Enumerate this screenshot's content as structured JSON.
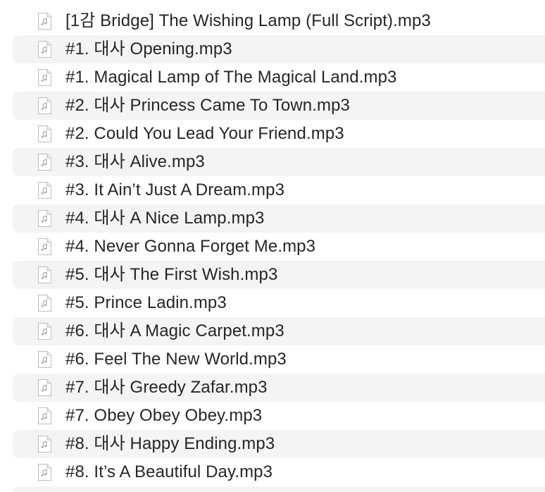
{
  "files": [
    {
      "name": "[1감 Bridge] The Wishing Lamp (Full Script).mp3",
      "icon": "audio-file-icon"
    },
    {
      "name": "#1. 대사 Opening.mp3",
      "icon": "audio-file-icon"
    },
    {
      "name": "#1. Magical Lamp of The Magical Land.mp3",
      "icon": "audio-file-icon"
    },
    {
      "name": "#2. 대사 Princess Came To Town.mp3",
      "icon": "audio-file-icon"
    },
    {
      "name": "#2. Could You Lead Your Friend.mp3",
      "icon": "audio-file-icon"
    },
    {
      "name": "#3. 대사 Alive.mp3",
      "icon": "audio-file-icon"
    },
    {
      "name": "#3. It Ain’t Just A Dream.mp3",
      "icon": "audio-file-icon"
    },
    {
      "name": "#4. 대사 A Nice Lamp.mp3",
      "icon": "audio-file-icon"
    },
    {
      "name": "#4. Never Gonna Forget Me.mp3",
      "icon": "audio-file-icon"
    },
    {
      "name": "#5. 대사 The First Wish.mp3",
      "icon": "audio-file-icon"
    },
    {
      "name": "#5. Prince Ladin.mp3",
      "icon": "audio-file-icon"
    },
    {
      "name": "#6. 대사 A Magic Carpet.mp3",
      "icon": "audio-file-icon"
    },
    {
      "name": "#6. Feel The New World.mp3",
      "icon": "audio-file-icon"
    },
    {
      "name": "#7. 대사 Greedy Zafar.mp3",
      "icon": "audio-file-icon"
    },
    {
      "name": "#7. Obey Obey Obey.mp3",
      "icon": "audio-file-icon"
    },
    {
      "name": "#8. 대사 Happy Ending.mp3",
      "icon": "audio-file-icon"
    },
    {
      "name": "#8. It’s A Beautiful Day.mp3",
      "icon": "audio-file-icon"
    }
  ],
  "colors": {
    "text": "#262626",
    "stripe": "#f4f4f5",
    "background": "#ffffff"
  }
}
